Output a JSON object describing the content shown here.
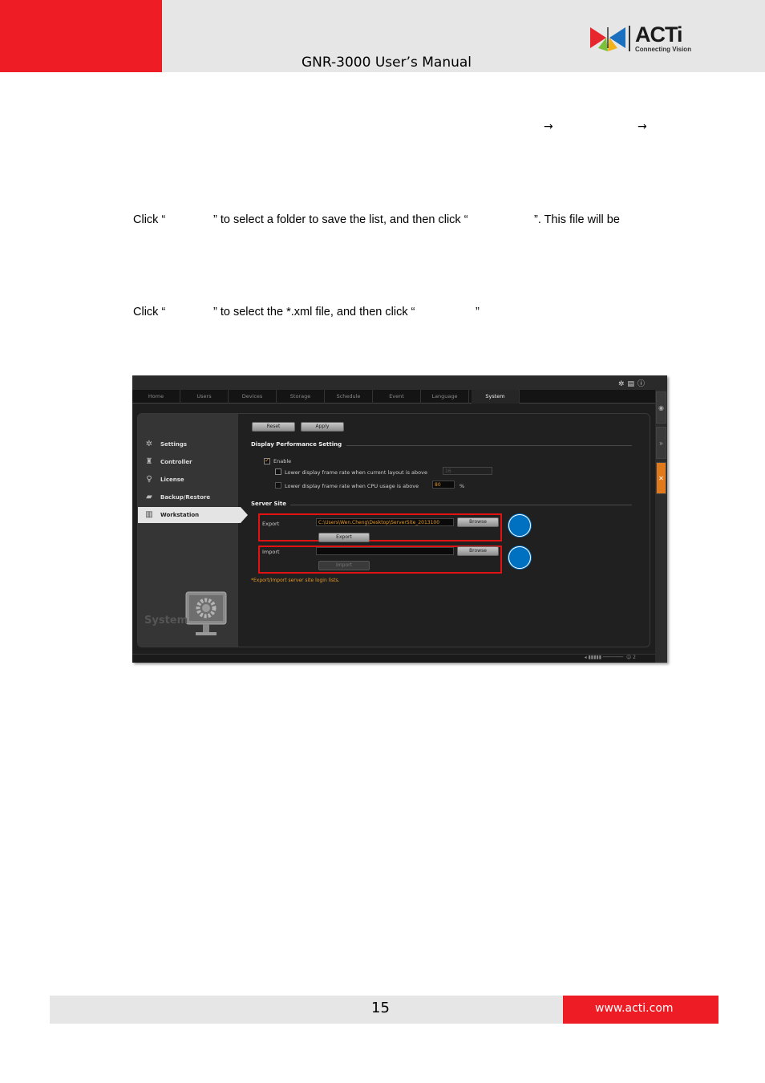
{
  "header": {
    "title": "GNR-3000 User’s Manual",
    "logo": {
      "word": "ACTi",
      "tagline": "Connecting Vision"
    }
  },
  "body": {
    "arrow_1": "→",
    "arrow_2": "→",
    "export_instruction": {
      "part1": "Click “",
      "part2": "” to select a folder to save the list, and then click “",
      "part3": "”. This file will be"
    },
    "import_instruction": {
      "part1": "Click “",
      "part2": "” to select the *.xml file, and then click “",
      "part3": "”"
    }
  },
  "app": {
    "tabs": [
      "Home",
      "Users",
      "Devices",
      "Storage",
      "Schedule",
      "Event",
      "Language",
      "System"
    ],
    "active_tab": "System",
    "nav": [
      "Settings",
      "Controller",
      "License",
      "Backup/Restore",
      "Workstation"
    ],
    "active_nav": "Workstation",
    "system_label": "System",
    "buttons": {
      "reset": "Reset",
      "apply": "Apply",
      "browse": "Browse",
      "export": "Export",
      "import": "Import"
    },
    "display_section": {
      "title": "Display Performance Setting",
      "enable_label": "Enable",
      "enable_checked": true,
      "frame_layout_label": "Lower display frame rate when current layout is above",
      "frame_layout_value": "16",
      "frame_cpu_label": "Lower display frame rate when CPU usage is above",
      "frame_cpu_value": "80",
      "percent": "%"
    },
    "server_site": {
      "title": "Server Site",
      "export_label": "Export",
      "export_path": "C:\\Users\\Wen.Cheng\\Desktop\\ServerSite_2013100",
      "import_label": "Import",
      "import_path": "",
      "note": "*Export/Import server site login lists."
    },
    "status": "2"
  },
  "colors": {
    "brand_red": "#ee1c25",
    "callout_blue": "#0070c0",
    "highlight_red": "#e31212",
    "accent_orange": "#e69a28"
  },
  "footer": {
    "page": "15",
    "url": "www.acti.com"
  }
}
